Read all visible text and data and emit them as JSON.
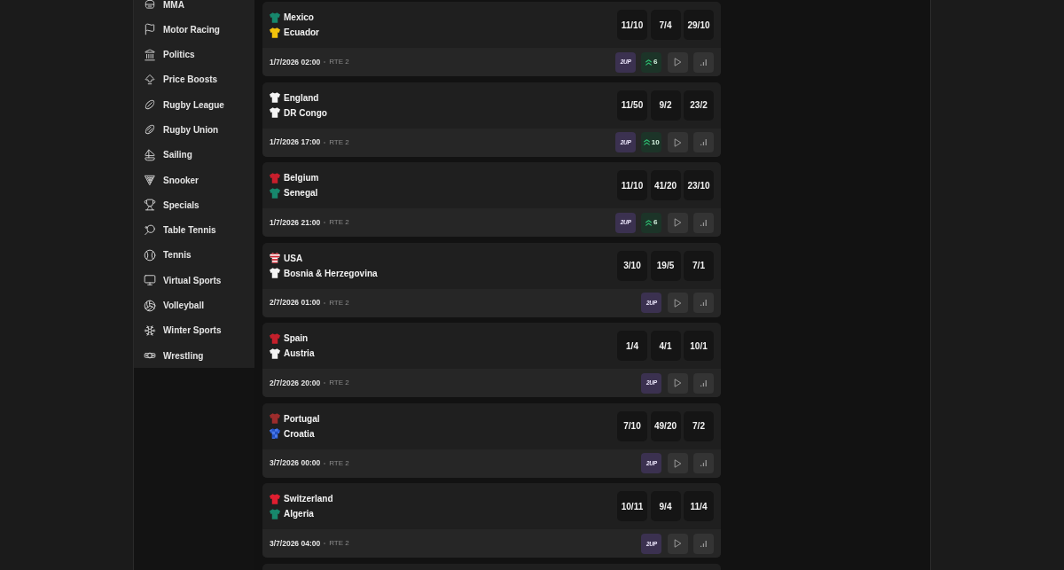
{
  "sidebar": {
    "items": [
      {
        "label": "MMA"
      },
      {
        "label": "Motor Racing"
      },
      {
        "label": "Politics"
      },
      {
        "label": "Price Boosts"
      },
      {
        "label": "Rugby League"
      },
      {
        "label": "Rugby Union"
      },
      {
        "label": "Sailing"
      },
      {
        "label": "Snooker"
      },
      {
        "label": "Specials"
      },
      {
        "label": "Table Tennis"
      },
      {
        "label": "Tennis"
      },
      {
        "label": "Virtual Sports"
      },
      {
        "label": "Volleyball"
      },
      {
        "label": "Winter Sports"
      },
      {
        "label": "Wrestling"
      }
    ]
  },
  "matches": [
    {
      "teams": [
        {
          "name": "Mexico",
          "kind": "plain",
          "color": "#17876c"
        },
        {
          "name": "Ecuador",
          "kind": "plain",
          "color": "#f2c20c"
        }
      ],
      "odds": [
        "11/10",
        "7/4",
        "29/10"
      ],
      "start_time": "1/7/2026 02:00",
      "channel": "RTE 2",
      "two_up": "2UP",
      "boost": {
        "count": "6"
      }
    },
    {
      "teams": [
        {
          "name": "England",
          "kind": "plain",
          "color": "#f4f4f4"
        },
        {
          "name": "DR Congo",
          "kind": "plain",
          "color": "#f4f4f4"
        }
      ],
      "odds": [
        "11/50",
        "9/2",
        "23/2"
      ],
      "start_time": "1/7/2026 17:00",
      "channel": "RTE 2",
      "two_up": "2UP",
      "boost": {
        "count": "10"
      }
    },
    {
      "teams": [
        {
          "name": "Belgium",
          "kind": "plain",
          "color": "#c81e2c"
        },
        {
          "name": "Senegal",
          "kind": "plain",
          "color": "#17876c"
        }
      ],
      "odds": [
        "11/10",
        "41/20",
        "23/10"
      ],
      "start_time": "1/7/2026 21:00",
      "channel": "RTE 2",
      "two_up": "2UP",
      "boost": {
        "count": "6"
      }
    },
    {
      "teams": [
        {
          "name": "USA",
          "kind": "stripes",
          "color": "#f4f4f4"
        },
        {
          "name": "Bosnia & Herzegovina",
          "kind": "plain",
          "color": "#f4f4f4"
        }
      ],
      "odds": [
        "3/10",
        "19/5",
        "7/1"
      ],
      "start_time": "2/7/2026 01:00",
      "channel": "RTE 2",
      "two_up": "2UP"
    },
    {
      "teams": [
        {
          "name": "Spain",
          "kind": "plain",
          "color": "#c41f2b"
        },
        {
          "name": "Austria",
          "kind": "plain",
          "color": "#f4f4f4"
        }
      ],
      "odds": [
        "1/4",
        "4/1",
        "10/1"
      ],
      "start_time": "2/7/2026 20:00",
      "channel": "RTE 2",
      "two_up": "2UP"
    },
    {
      "teams": [
        {
          "name": "Portugal",
          "kind": "plain",
          "color": "#9c2c2c"
        },
        {
          "name": "Croatia",
          "kind": "checks",
          "color": "#1f4fc4"
        }
      ],
      "odds": [
        "7/10",
        "49/20",
        "7/2"
      ],
      "start_time": "3/7/2026 00:00",
      "channel": "RTE 2",
      "two_up": "2UP"
    },
    {
      "teams": [
        {
          "name": "Switzerland",
          "kind": "plain",
          "color": "#e01e30"
        },
        {
          "name": "Algeria",
          "kind": "plain",
          "color": "#17876c"
        }
      ],
      "odds": [
        "10/11",
        "9/4",
        "11/4"
      ],
      "start_time": "3/7/2026 04:00",
      "channel": "RTE 2",
      "two_up": "2UP"
    }
  ]
}
